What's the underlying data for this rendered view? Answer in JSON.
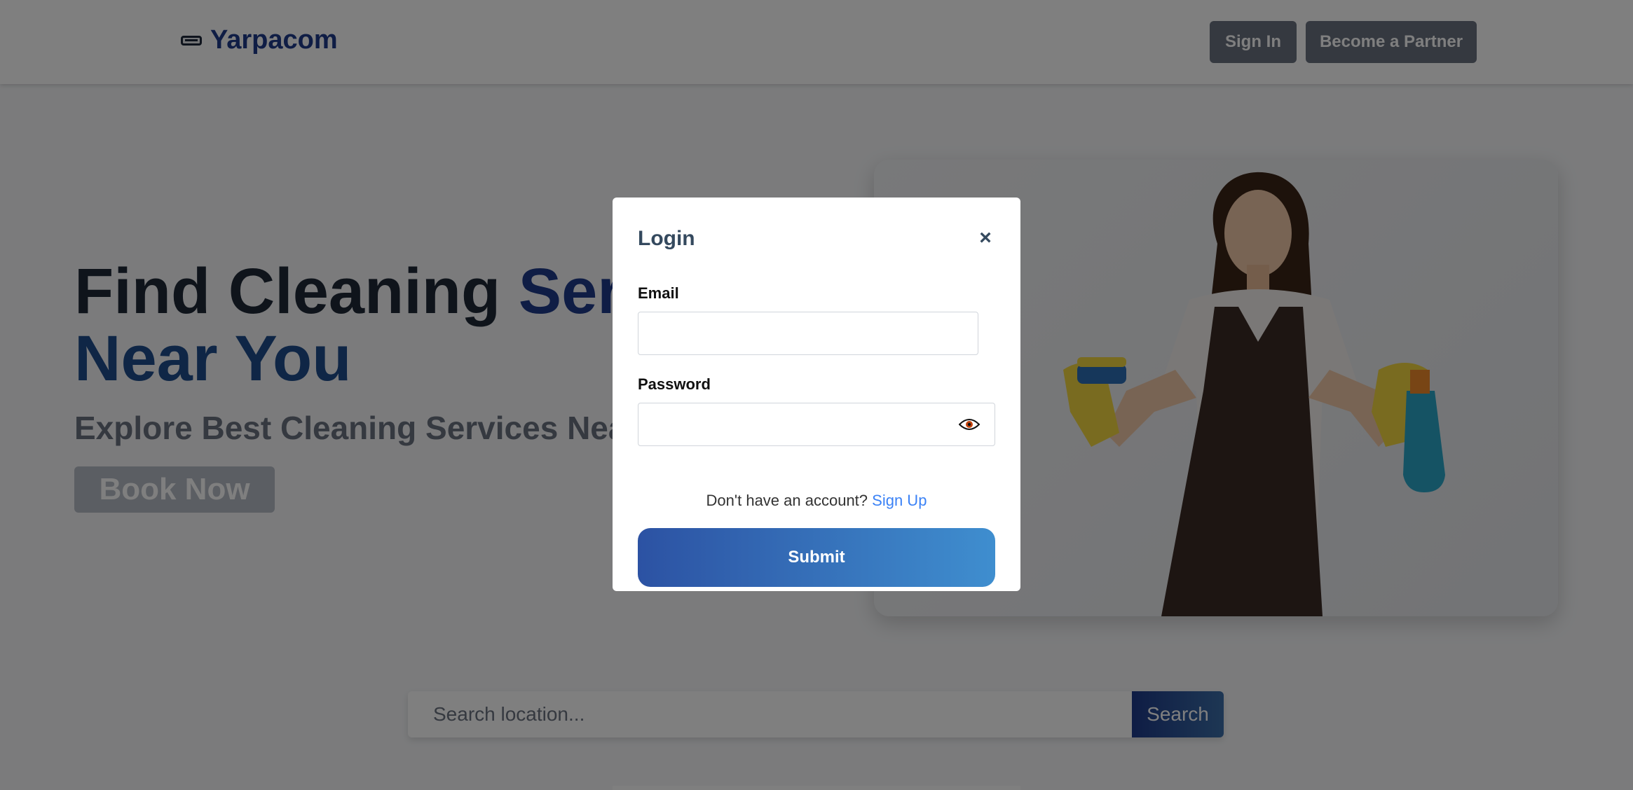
{
  "navbar": {
    "brand": "Yarpacom",
    "sign_in": "Sign In",
    "become_partner": "Become a Partner"
  },
  "hero": {
    "title_part1": "Find Cleaning ",
    "title_part2": "Services",
    "title_line2": "Near You",
    "subtitle": "Explore Best Cleaning Services Near You",
    "book_button": "Book Now"
  },
  "search": {
    "placeholder": "Search location...",
    "button": "Search"
  },
  "modal": {
    "title": "Login",
    "close_symbol": "×",
    "email_label": "Email",
    "password_label": "Password",
    "no_account_text": "Don't have an account?",
    "sign_up_link": "Sign Up",
    "submit": "Submit"
  },
  "colors": {
    "brand": "#1e3a8a",
    "overlay": "rgba(0,0,0,0.5)",
    "submit_gradient_start": "#2c52a3",
    "submit_gradient_end": "#3f8ecf",
    "link": "#3b82f6"
  },
  "icons": [
    "car-icon",
    "close-icon",
    "eye-icon"
  ]
}
